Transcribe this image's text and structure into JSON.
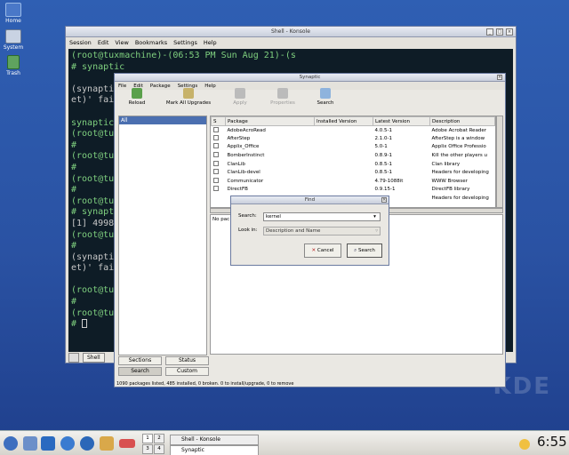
{
  "desktop": {
    "icons": [
      {
        "label": "Home"
      },
      {
        "label": "System"
      },
      {
        "label": "Trash"
      }
    ],
    "wallpaper_text": "KDE"
  },
  "konsole": {
    "title": "Shell - Konsole",
    "menu": [
      "Session",
      "Edit",
      "View",
      "Bookmarks",
      "Settings",
      "Help"
    ],
    "terminal_lines": [
      "(root@tuxmachine)-(06:53 PM Sun Aug 21)-(s",
      "# synaptic",
      "",
      "(synaptic",
      "et)' fai",
      "",
      "synaptic",
      "(root@tu",
      "#",
      "(root@tu",
      "#",
      "(root@tu",
      "#",
      "(root@tu",
      "# synapt",
      "[1] 4998",
      "(root@tu",
      "#",
      "(synaptic",
      "et)' fai",
      "",
      "(root@tu",
      "#",
      "(root@tu",
      "# "
    ],
    "tab_label": "Shell"
  },
  "synaptic": {
    "title": "Synaptic",
    "menu": [
      "File",
      "Edit",
      "Package",
      "Settings",
      "Help"
    ],
    "toolbar": [
      {
        "label": "Reload",
        "icon": "reload-icon"
      },
      {
        "label": "Mark All Upgrades",
        "icon": "upgrade-icon"
      },
      {
        "label": "Apply",
        "icon": "apply-icon"
      },
      {
        "label": "Properties",
        "icon": "properties-icon"
      },
      {
        "label": "Search",
        "icon": "search-icon"
      }
    ],
    "filter_selected": "All",
    "columns": [
      "S",
      "Package",
      "Installed Version",
      "Latest Version",
      "Description"
    ],
    "packages": [
      {
        "name": "AdobeAcroRead",
        "installed": "",
        "latest": "4.0.5-1",
        "desc": "Adobe Acrobat Reader"
      },
      {
        "name": "AfterStep",
        "installed": "",
        "latest": "2.1.0-1",
        "desc": "AfterStep is a window"
      },
      {
        "name": "Applix_Office",
        "installed": "",
        "latest": "5.0-1",
        "desc": "Applix Office Professio"
      },
      {
        "name": "BomberInstinct",
        "installed": "",
        "latest": "0.8.9-1",
        "desc": "Kill the other players u"
      },
      {
        "name": "ClanLib",
        "installed": "",
        "latest": "0.8.5-1",
        "desc": "Clan library"
      },
      {
        "name": "ClanLib-devel",
        "installed": "",
        "latest": "0.8.5-1",
        "desc": "Headers for developing"
      },
      {
        "name": "Communicator",
        "installed": "",
        "latest": "4.79-1088it",
        "desc": "WWW Browser"
      },
      {
        "name": "DirectFB",
        "installed": "",
        "latest": "0.9.15-1",
        "desc": "DirectFB library"
      },
      {
        "name": "",
        "installed": "",
        "latest": "",
        "desc": "Headers for developing"
      }
    ],
    "description_text": "No pac",
    "left_buttons": [
      "Sections",
      "Status",
      "Search",
      "Custom"
    ],
    "active_left_button": "Search",
    "status": "1090 packages listed, 485 installed, 0 broken. 0 to install/upgrade, 0 to remove"
  },
  "find_dialog": {
    "title": "Find",
    "search_label": "Search:",
    "search_value": "kernel",
    "lookin_label": "Look in:",
    "lookin_value": "Description and Name",
    "cancel_label": "Cancel",
    "search_button_label": "Search"
  },
  "taskbar": {
    "pager": [
      "1",
      "2",
      "3",
      "4"
    ],
    "active_desktop": "1",
    "tasks": [
      "Shell - Konsole",
      "Synaptic"
    ],
    "clock": "6:55"
  }
}
